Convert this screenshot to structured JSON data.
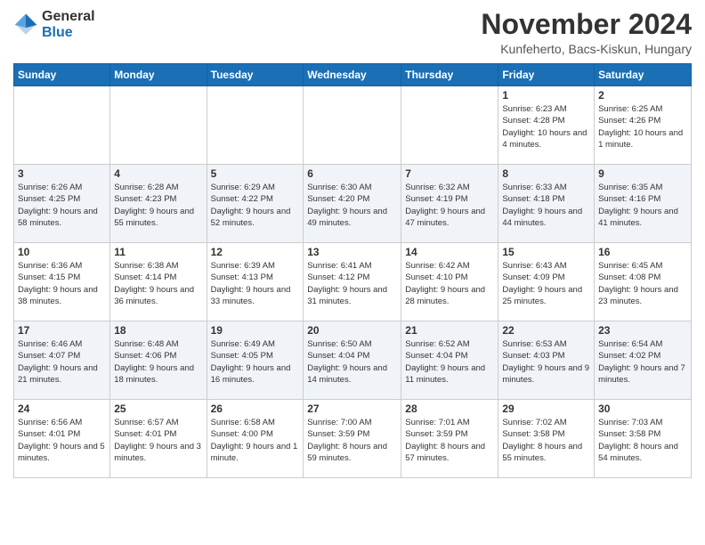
{
  "header": {
    "logo": {
      "text_general": "General",
      "text_blue": "Blue"
    },
    "title": "November 2024",
    "location": "Kunfeherto, Bacs-Kiskun, Hungary"
  },
  "weekdays": [
    "Sunday",
    "Monday",
    "Tuesday",
    "Wednesday",
    "Thursday",
    "Friday",
    "Saturday"
  ],
  "weeks": [
    {
      "days": [
        {
          "num": "",
          "info": ""
        },
        {
          "num": "",
          "info": ""
        },
        {
          "num": "",
          "info": ""
        },
        {
          "num": "",
          "info": ""
        },
        {
          "num": "",
          "info": ""
        },
        {
          "num": "1",
          "info": "Sunrise: 6:23 AM\nSunset: 4:28 PM\nDaylight: 10 hours and 4 minutes."
        },
        {
          "num": "2",
          "info": "Sunrise: 6:25 AM\nSunset: 4:26 PM\nDaylight: 10 hours and 1 minute."
        }
      ]
    },
    {
      "days": [
        {
          "num": "3",
          "info": "Sunrise: 6:26 AM\nSunset: 4:25 PM\nDaylight: 9 hours and 58 minutes."
        },
        {
          "num": "4",
          "info": "Sunrise: 6:28 AM\nSunset: 4:23 PM\nDaylight: 9 hours and 55 minutes."
        },
        {
          "num": "5",
          "info": "Sunrise: 6:29 AM\nSunset: 4:22 PM\nDaylight: 9 hours and 52 minutes."
        },
        {
          "num": "6",
          "info": "Sunrise: 6:30 AM\nSunset: 4:20 PM\nDaylight: 9 hours and 49 minutes."
        },
        {
          "num": "7",
          "info": "Sunrise: 6:32 AM\nSunset: 4:19 PM\nDaylight: 9 hours and 47 minutes."
        },
        {
          "num": "8",
          "info": "Sunrise: 6:33 AM\nSunset: 4:18 PM\nDaylight: 9 hours and 44 minutes."
        },
        {
          "num": "9",
          "info": "Sunrise: 6:35 AM\nSunset: 4:16 PM\nDaylight: 9 hours and 41 minutes."
        }
      ]
    },
    {
      "days": [
        {
          "num": "10",
          "info": "Sunrise: 6:36 AM\nSunset: 4:15 PM\nDaylight: 9 hours and 38 minutes."
        },
        {
          "num": "11",
          "info": "Sunrise: 6:38 AM\nSunset: 4:14 PM\nDaylight: 9 hours and 36 minutes."
        },
        {
          "num": "12",
          "info": "Sunrise: 6:39 AM\nSunset: 4:13 PM\nDaylight: 9 hours and 33 minutes."
        },
        {
          "num": "13",
          "info": "Sunrise: 6:41 AM\nSunset: 4:12 PM\nDaylight: 9 hours and 31 minutes."
        },
        {
          "num": "14",
          "info": "Sunrise: 6:42 AM\nSunset: 4:10 PM\nDaylight: 9 hours and 28 minutes."
        },
        {
          "num": "15",
          "info": "Sunrise: 6:43 AM\nSunset: 4:09 PM\nDaylight: 9 hours and 25 minutes."
        },
        {
          "num": "16",
          "info": "Sunrise: 6:45 AM\nSunset: 4:08 PM\nDaylight: 9 hours and 23 minutes."
        }
      ]
    },
    {
      "days": [
        {
          "num": "17",
          "info": "Sunrise: 6:46 AM\nSunset: 4:07 PM\nDaylight: 9 hours and 21 minutes."
        },
        {
          "num": "18",
          "info": "Sunrise: 6:48 AM\nSunset: 4:06 PM\nDaylight: 9 hours and 18 minutes."
        },
        {
          "num": "19",
          "info": "Sunrise: 6:49 AM\nSunset: 4:05 PM\nDaylight: 9 hours and 16 minutes."
        },
        {
          "num": "20",
          "info": "Sunrise: 6:50 AM\nSunset: 4:04 PM\nDaylight: 9 hours and 14 minutes."
        },
        {
          "num": "21",
          "info": "Sunrise: 6:52 AM\nSunset: 4:04 PM\nDaylight: 9 hours and 11 minutes."
        },
        {
          "num": "22",
          "info": "Sunrise: 6:53 AM\nSunset: 4:03 PM\nDaylight: 9 hours and 9 minutes."
        },
        {
          "num": "23",
          "info": "Sunrise: 6:54 AM\nSunset: 4:02 PM\nDaylight: 9 hours and 7 minutes."
        }
      ]
    },
    {
      "days": [
        {
          "num": "24",
          "info": "Sunrise: 6:56 AM\nSunset: 4:01 PM\nDaylight: 9 hours and 5 minutes."
        },
        {
          "num": "25",
          "info": "Sunrise: 6:57 AM\nSunset: 4:01 PM\nDaylight: 9 hours and 3 minutes."
        },
        {
          "num": "26",
          "info": "Sunrise: 6:58 AM\nSunset: 4:00 PM\nDaylight: 9 hours and 1 minute."
        },
        {
          "num": "27",
          "info": "Sunrise: 7:00 AM\nSunset: 3:59 PM\nDaylight: 8 hours and 59 minutes."
        },
        {
          "num": "28",
          "info": "Sunrise: 7:01 AM\nSunset: 3:59 PM\nDaylight: 8 hours and 57 minutes."
        },
        {
          "num": "29",
          "info": "Sunrise: 7:02 AM\nSunset: 3:58 PM\nDaylight: 8 hours and 55 minutes."
        },
        {
          "num": "30",
          "info": "Sunrise: 7:03 AM\nSunset: 3:58 PM\nDaylight: 8 hours and 54 minutes."
        }
      ]
    }
  ]
}
